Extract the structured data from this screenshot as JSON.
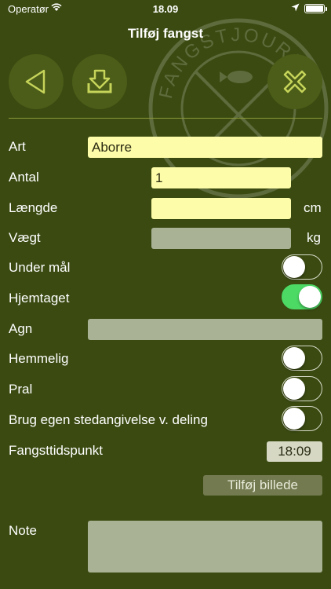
{
  "status_bar": {
    "carrier": "Operatør",
    "time": "18.09",
    "wifi_icon": "wifi-icon",
    "location_icon": "location-arrow-icon",
    "battery_icon": "battery-icon",
    "battery_level": 1.0
  },
  "header": {
    "title": "Tilføj fangst"
  },
  "toolbar": {
    "back_icon": "back-triangle-icon",
    "save_icon": "download-icon",
    "cancel_icon": "close-x-icon"
  },
  "watermark": {
    "text": "FANGSTJOURNAL"
  },
  "form": {
    "species": {
      "label": "Art",
      "value": "Aborre"
    },
    "count": {
      "label": "Antal",
      "value": "1"
    },
    "length": {
      "label": "Længde",
      "value": "",
      "unit": "cm"
    },
    "weight": {
      "label": "Vægt",
      "value": "",
      "unit": "kg"
    },
    "undersized": {
      "label": "Under mål",
      "on": false
    },
    "kept": {
      "label": "Hjemtaget",
      "on": true
    },
    "bait": {
      "label": "Agn",
      "value": ""
    },
    "secret": {
      "label": "Hemmelig",
      "on": false
    },
    "brag": {
      "label": "Pral",
      "on": false
    },
    "own_location": {
      "label": "Brug egen stedangivelse v. deling",
      "on": false
    },
    "catch_time": {
      "label": "Fangsttidspunkt",
      "value": "18:09"
    },
    "add_photo_label": "Tilføj billede",
    "note": {
      "label": "Note",
      "value": ""
    }
  },
  "colors": {
    "background": "#3a4a11",
    "input_yellow": "#fdfca8",
    "input_disabled": "#a9b295",
    "toggle_on": "#4cd964"
  }
}
